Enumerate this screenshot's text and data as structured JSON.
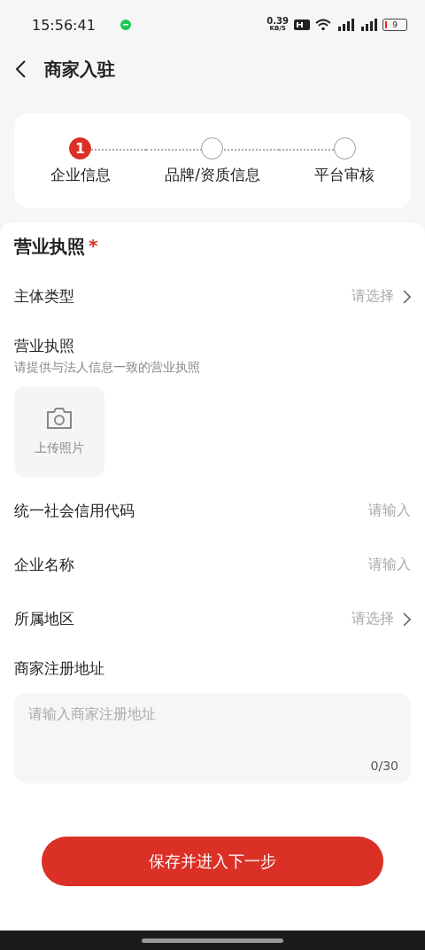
{
  "status_bar": {
    "time": "15:56:41",
    "net_speed": "0.39",
    "net_unit": "KB/S",
    "battery": "9"
  },
  "header": {
    "title": "商家入驻"
  },
  "steps": [
    {
      "number": "1",
      "label": "企业信息",
      "selected": true
    },
    {
      "label": "品牌/资质信息",
      "selected": false
    },
    {
      "label": "平台审核",
      "selected": false
    }
  ],
  "section": {
    "title": "营业执照",
    "required_mark": "*"
  },
  "fields": [
    {
      "kind": "select",
      "label": "主体类型",
      "placeholder": "请选择"
    },
    {
      "kind": "upload",
      "label": "营业执照",
      "hint": "请提供与法人信息一致的营业执照",
      "upload_label": "上传照片"
    },
    {
      "kind": "input",
      "label": "统一社会信用代码",
      "placeholder": "请输入"
    },
    {
      "kind": "input",
      "label": "企业名称",
      "placeholder": "请输入"
    },
    {
      "kind": "select",
      "label": "所属地区",
      "placeholder": "请选择"
    },
    {
      "kind": "textarea",
      "label": "商家注册地址",
      "placeholder": "请输入商家注册地址",
      "counter": "0/30"
    }
  ],
  "submit_button": "保存并进入下一步"
}
